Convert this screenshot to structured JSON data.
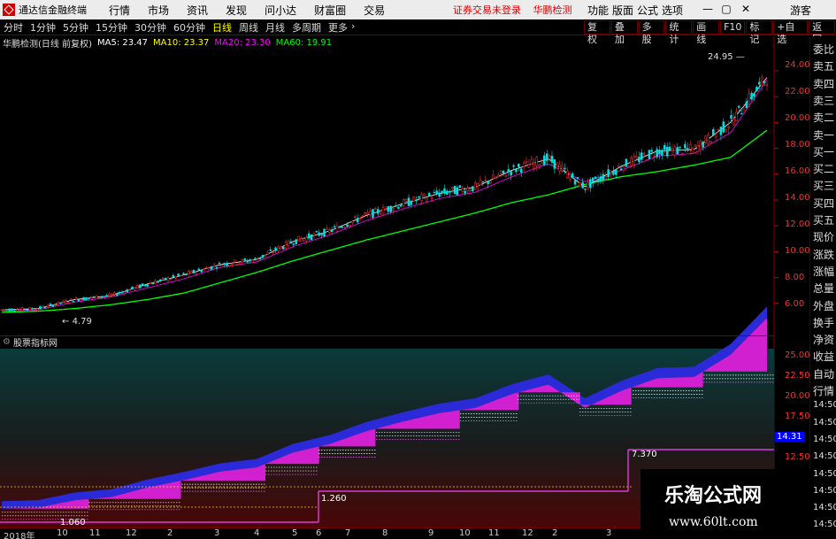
{
  "titlebar": {
    "app_name": "通达信金融终端",
    "menu": [
      "行情",
      "市场",
      "资讯",
      "发现",
      "问小达",
      "财富圈",
      "交易"
    ],
    "notice": [
      "证券交易未登录",
      "华鹏检测"
    ],
    "right_menu": [
      "功能",
      "版面",
      "公式",
      "选项"
    ],
    "guest": "游客",
    "colors": {
      "bg": "#ececec",
      "notice": "#dd0000",
      "logo": "#cc0000"
    }
  },
  "toolbar": {
    "periods": [
      "分时",
      "1分钟",
      "5分钟",
      "15分钟",
      "30分钟",
      "60分钟",
      "日线",
      "周线",
      "月线",
      "多周期",
      "更多"
    ],
    "active_period": "日线",
    "tools": [
      "复权",
      "叠加",
      "多股",
      "统计",
      "画线",
      "F10",
      "标记",
      "+自选",
      "返回"
    ]
  },
  "chart_header": {
    "name": "华鹏检测(日线 前复权)",
    "ma5": "MA5: 23.47",
    "ma10": "MA10: 23.37",
    "ma20": "MA20: 23.30",
    "ma60": "MA60: 19.91",
    "colors": {
      "ma5": "#ffffff",
      "ma10": "#ffff00",
      "ma20": "#ff00ff",
      "ma60": "#00ff00"
    }
  },
  "price_annotations": {
    "high": "24.95",
    "low": "4.79"
  },
  "price_axis": [
    "24.00",
    "22.00",
    "20.00",
    "18.00",
    "16.00",
    "14.00",
    "12.00",
    "10.00",
    "8.00",
    "6.00"
  ],
  "right_panel": [
    "委比",
    "卖五",
    "卖四",
    "卖三",
    "卖二",
    "卖一",
    "买一",
    "买二",
    "买三",
    "买四",
    "买五",
    "现价",
    "涨跌",
    "涨幅",
    "总量",
    "外盘",
    "换手",
    "净资",
    "收益",
    "自动",
    "行情",
    "14:50",
    "14:50",
    "14:50",
    "14:50",
    "14:50",
    "14:50",
    "14:50",
    "14:50"
  ],
  "indicator": {
    "name": "股票指标网",
    "axis": [
      "25.00",
      "22.50",
      "20.00",
      "17.50",
      "15.00",
      "12.50"
    ],
    "current": "14.31",
    "labels": {
      "a": "7.370",
      "b": "1.260",
      "c": "1.060"
    }
  },
  "time_axis": {
    "labels": [
      "2018年",
      "10",
      "11",
      "12",
      "2",
      "3",
      "4",
      "5",
      "6",
      "7",
      "8",
      "9",
      "10",
      "11",
      "12",
      "2",
      "3"
    ]
  },
  "watermark": {
    "line1": "乐淘公式网",
    "line2": "www.60lt.com"
  },
  "chart_data": {
    "type": "line",
    "title": "华鹏检测(日线 前复权)",
    "ylim": [
      4.0,
      25.5
    ],
    "series": [
      {
        "name": "MA60",
        "color": "#00ff00",
        "values": [
          5.3,
          5.4,
          5.6,
          5.9,
          6.3,
          6.8,
          7.6,
          8.4,
          9.3,
          10.1,
          10.9,
          11.6,
          12.3,
          13.0,
          13.8,
          14.4,
          15.2,
          15.8,
          16.2,
          16.7,
          17.3,
          19.4
        ]
      },
      {
        "name": "MA20",
        "color": "#ff00ff",
        "values": [
          5.4,
          5.5,
          6.1,
          6.5,
          7.2,
          7.9,
          8.8,
          9.2,
          10.4,
          11.3,
          12.4,
          13.3,
          14.1,
          14.6,
          15.8,
          16.8,
          15.4,
          16.3,
          17.4,
          17.6,
          19.2,
          23.3
        ]
      },
      {
        "name": "MA5",
        "color": "#ffffff",
        "values": [
          5.5,
          5.6,
          6.3,
          6.6,
          7.5,
          8.2,
          9.0,
          9.4,
          10.8,
          11.6,
          12.8,
          13.7,
          14.5,
          15.0,
          16.3,
          17.2,
          15.0,
          16.6,
          17.8,
          17.9,
          20.0,
          23.47
        ]
      }
    ]
  }
}
